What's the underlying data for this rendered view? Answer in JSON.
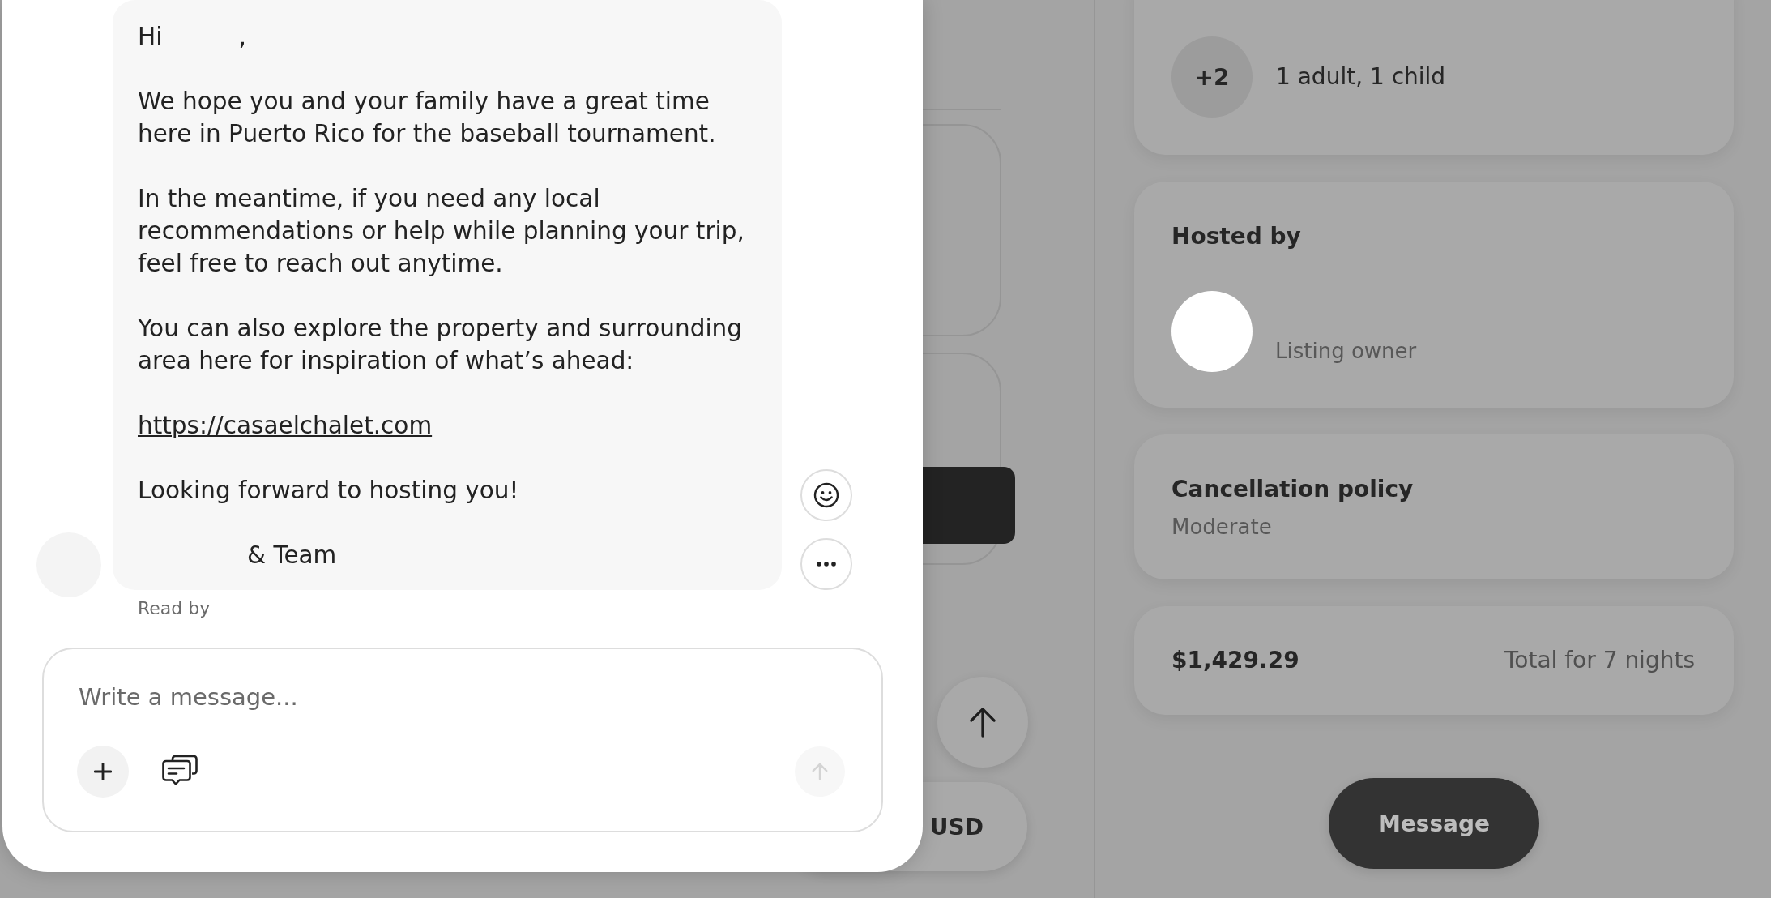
{
  "chat": {
    "message": {
      "blocks": [
        {
          "kind": "greeting",
          "text": "Hi",
          "end": ","
        },
        {
          "kind": "text",
          "text": "We hope you and your family have a great time\nhere in Puerto Rico for the baseball tournament."
        },
        {
          "kind": "text",
          "text": "In the meantime, if you need any local\nrecommendations or help while planning your trip,\nfeel free to reach out anytime."
        },
        {
          "kind": "text",
          "text": "You can also explore the property and surrounding\narea here for inspiration of what’s ahead:"
        },
        {
          "kind": "link",
          "text": "https://casaelchalet.com"
        },
        {
          "kind": "text",
          "text": "Looking forward to hosting you!"
        },
        {
          "kind": "signature",
          "text": "& Team"
        }
      ]
    },
    "read_receipt": "Read by",
    "composer": {
      "placeholder": "Write a message...",
      "send_button": {
        "disabled": true
      }
    }
  },
  "page": {
    "currency": "USD"
  },
  "sidebar": {
    "guests": {
      "badge": "+2",
      "text": "1 adult, 1 child"
    },
    "host": {
      "heading": "Hosted by",
      "role": "Listing owner"
    },
    "cancellation": {
      "heading": "Cancellation policy",
      "value": "Moderate"
    },
    "price": {
      "amount": "$1,429.29",
      "label": "Total for 7 nights"
    },
    "message_button": "Message"
  }
}
